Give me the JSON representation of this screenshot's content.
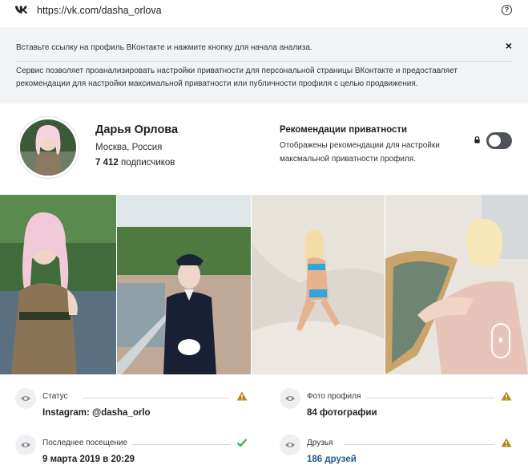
{
  "url_bar": {
    "url": "https://vk.com/dasha_orlova"
  },
  "info": {
    "line1": "Вставьте ссылку на профиль ВКонтакте и нажмите кнопку для начала анализа.",
    "line2": "Сервис позволяет проанализировать настройки приватности для персональной страницы ВКонтакте и предоставляет рекомендации для настройки максимальной приватности или публичности профиля с целью продвижения.",
    "close": "×"
  },
  "profile": {
    "name": "Дарья Орлова",
    "city": "Москва, Россия",
    "subscribers_count": "7 412",
    "subscribers_label": " подписчиков"
  },
  "recommendations": {
    "title": "Рекомендации приватности",
    "description": "Отображены рекомендации для настройки максмальной приватности профиля.",
    "toggle_on": false
  },
  "stats": {
    "status": {
      "label": "Статус",
      "value": "Instagram: @dasha_orlo",
      "state": "warning"
    },
    "photos": {
      "label": "Фото профиля",
      "value": "84 фотографии",
      "state": "warning"
    },
    "last_seen": {
      "label": "Последнее посещение",
      "value": "9 марта 2019 в 20:29",
      "state": "ok"
    },
    "friends": {
      "label": "Друзья",
      "value": "186 друзей",
      "state": "warning"
    }
  },
  "colors": {
    "warning": "#b58a14",
    "ok": "#2bb24c",
    "link": "#2a5885",
    "toggle": "#4f5359"
  }
}
